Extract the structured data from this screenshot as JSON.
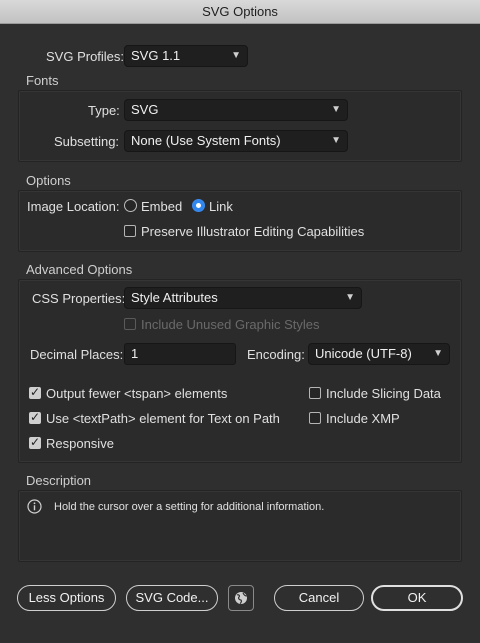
{
  "window": {
    "title": "SVG Options"
  },
  "profiles": {
    "label": "SVG Profiles:",
    "value": "SVG 1.1"
  },
  "fonts": {
    "title": "Fonts",
    "type_label": "Type:",
    "type_value": "SVG",
    "subsetting_label": "Subsetting:",
    "subsetting_value": "None (Use System Fonts)"
  },
  "options": {
    "title": "Options",
    "image_location_label": "Image Location:",
    "embed_label": "Embed",
    "link_label": "Link",
    "image_location_selected": "Link",
    "preserve_label": "Preserve Illustrator Editing Capabilities",
    "preserve_checked": false
  },
  "advanced": {
    "title": "Advanced Options",
    "css_label": "CSS Properties:",
    "css_value": "Style Attributes",
    "unused_styles_label": "Include Unused Graphic Styles",
    "decimal_label": "Decimal Places:",
    "decimal_value": "1",
    "encoding_label": "Encoding:",
    "encoding_value": "Unicode (UTF-8)",
    "fewer_tspan_label": "Output fewer <tspan> elements",
    "fewer_tspan_checked": true,
    "textpath_label": "Use <textPath> element for Text on Path",
    "textpath_checked": true,
    "responsive_label": "Responsive",
    "responsive_checked": true,
    "slicing_label": "Include Slicing Data",
    "slicing_checked": false,
    "xmp_label": "Include XMP",
    "xmp_checked": false
  },
  "description": {
    "title": "Description",
    "text": "Hold the cursor over a setting for additional information."
  },
  "buttons": {
    "less_options": "Less Options",
    "svg_code": "SVG Code...",
    "cancel": "Cancel",
    "ok": "OK"
  },
  "colors": {
    "accent": "#2f86ef",
    "background": "#2f2f2f"
  }
}
